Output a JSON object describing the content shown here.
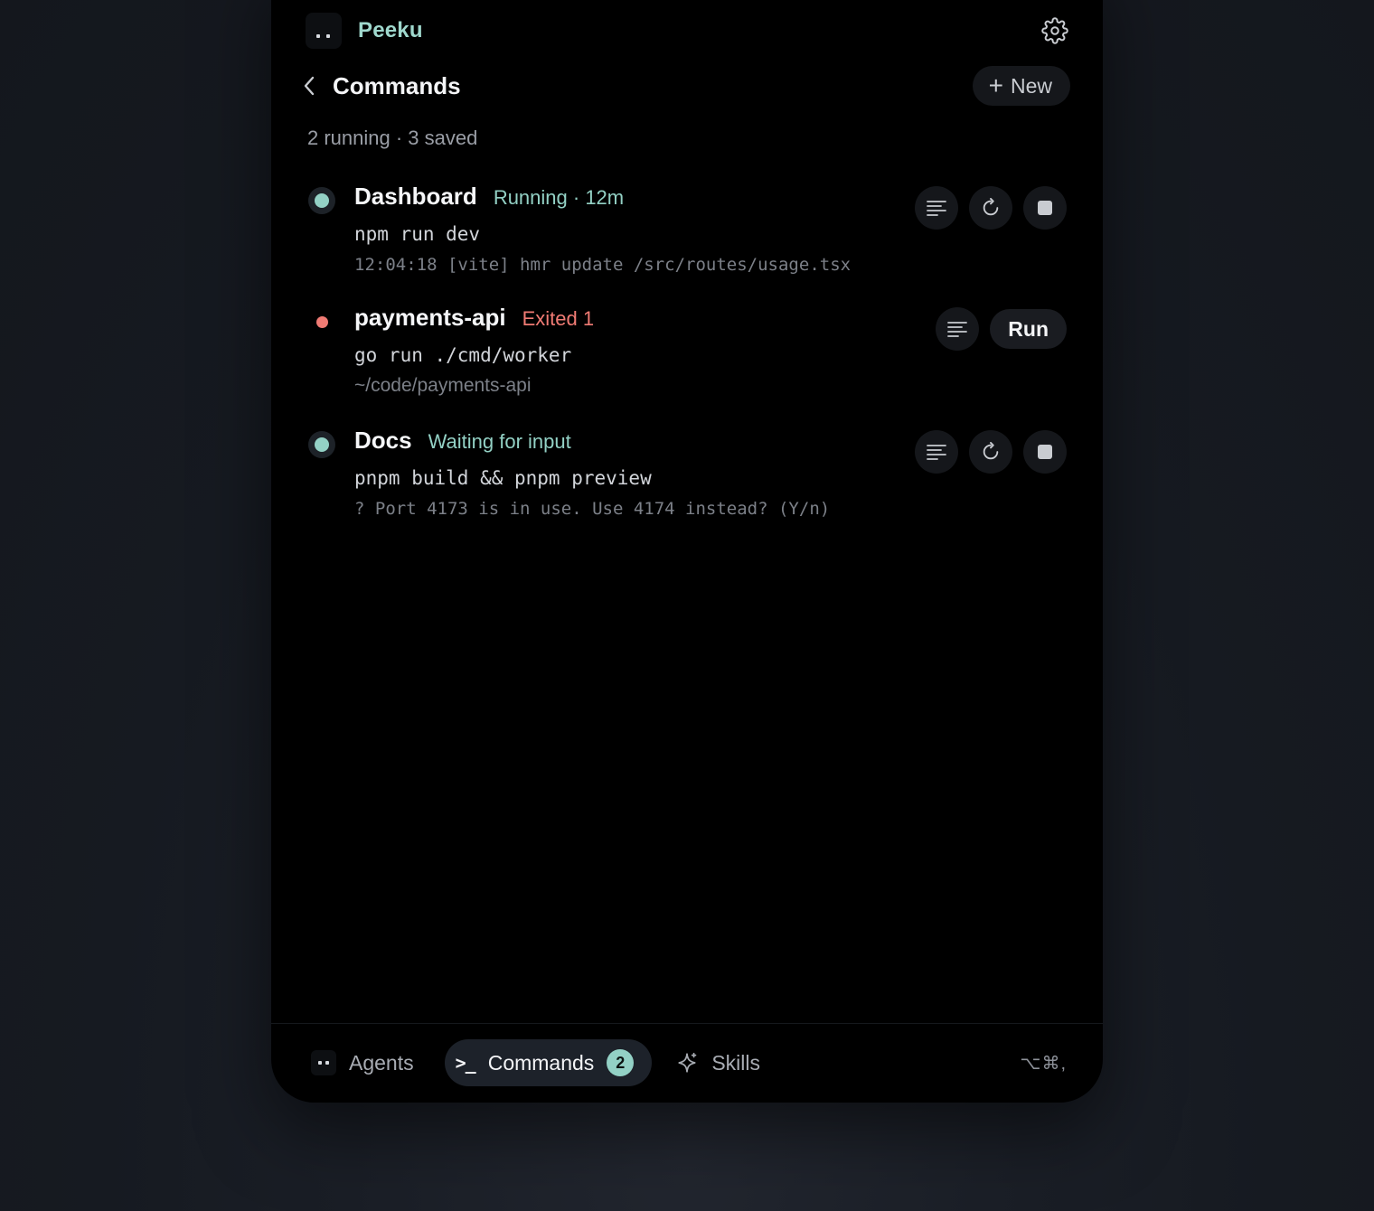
{
  "app": {
    "name": "Peeku",
    "logo_icon": "peeku-face-icon",
    "settings_icon": "gear-icon"
  },
  "header": {
    "title": "Commands",
    "back_icon": "chevron-left-icon",
    "new_button": {
      "icon": "plus-icon",
      "label": "New"
    }
  },
  "summary": "2 running · 3 saved",
  "commands": [
    {
      "name": "Dashboard",
      "status": "Running · 12m",
      "status_kind": "running",
      "command": "npm run dev",
      "detail": "12:04:18 [vite] hmr update /src/routes/usage.tsx",
      "actions": [
        "logs-icon",
        "restart-icon",
        "stop-icon"
      ]
    },
    {
      "name": "payments-api",
      "status": "Exited 1",
      "status_kind": "exited",
      "command": "go run ./cmd/worker",
      "detail": "~/code/payments-api",
      "actions": [
        "logs-icon"
      ],
      "run_label": "Run"
    },
    {
      "name": "Docs",
      "status": "Waiting for input",
      "status_kind": "waiting",
      "command": "pnpm build && pnpm preview",
      "detail": "? Port 4173 is in use. Use 4174 instead? (Y/n)",
      "actions": [
        "logs-icon",
        "restart-icon",
        "stop-icon"
      ]
    }
  ],
  "bottom_nav": {
    "items": [
      {
        "label": "Agents",
        "icon": "agents-face-icon",
        "active": false
      },
      {
        "label": "Commands",
        "icon": "terminal-prompt-icon",
        "prefix": ">_",
        "active": true,
        "badge": "2"
      },
      {
        "label": "Skills",
        "icon": "sparkle-icon",
        "active": false
      }
    ],
    "shortcut": "⌥⌘,"
  },
  "colors": {
    "accent": "#93d1c5",
    "brand": "#9fd8cd",
    "error": "#f07b74",
    "panel_bg": "#000000",
    "button_bg": "#15171b"
  }
}
